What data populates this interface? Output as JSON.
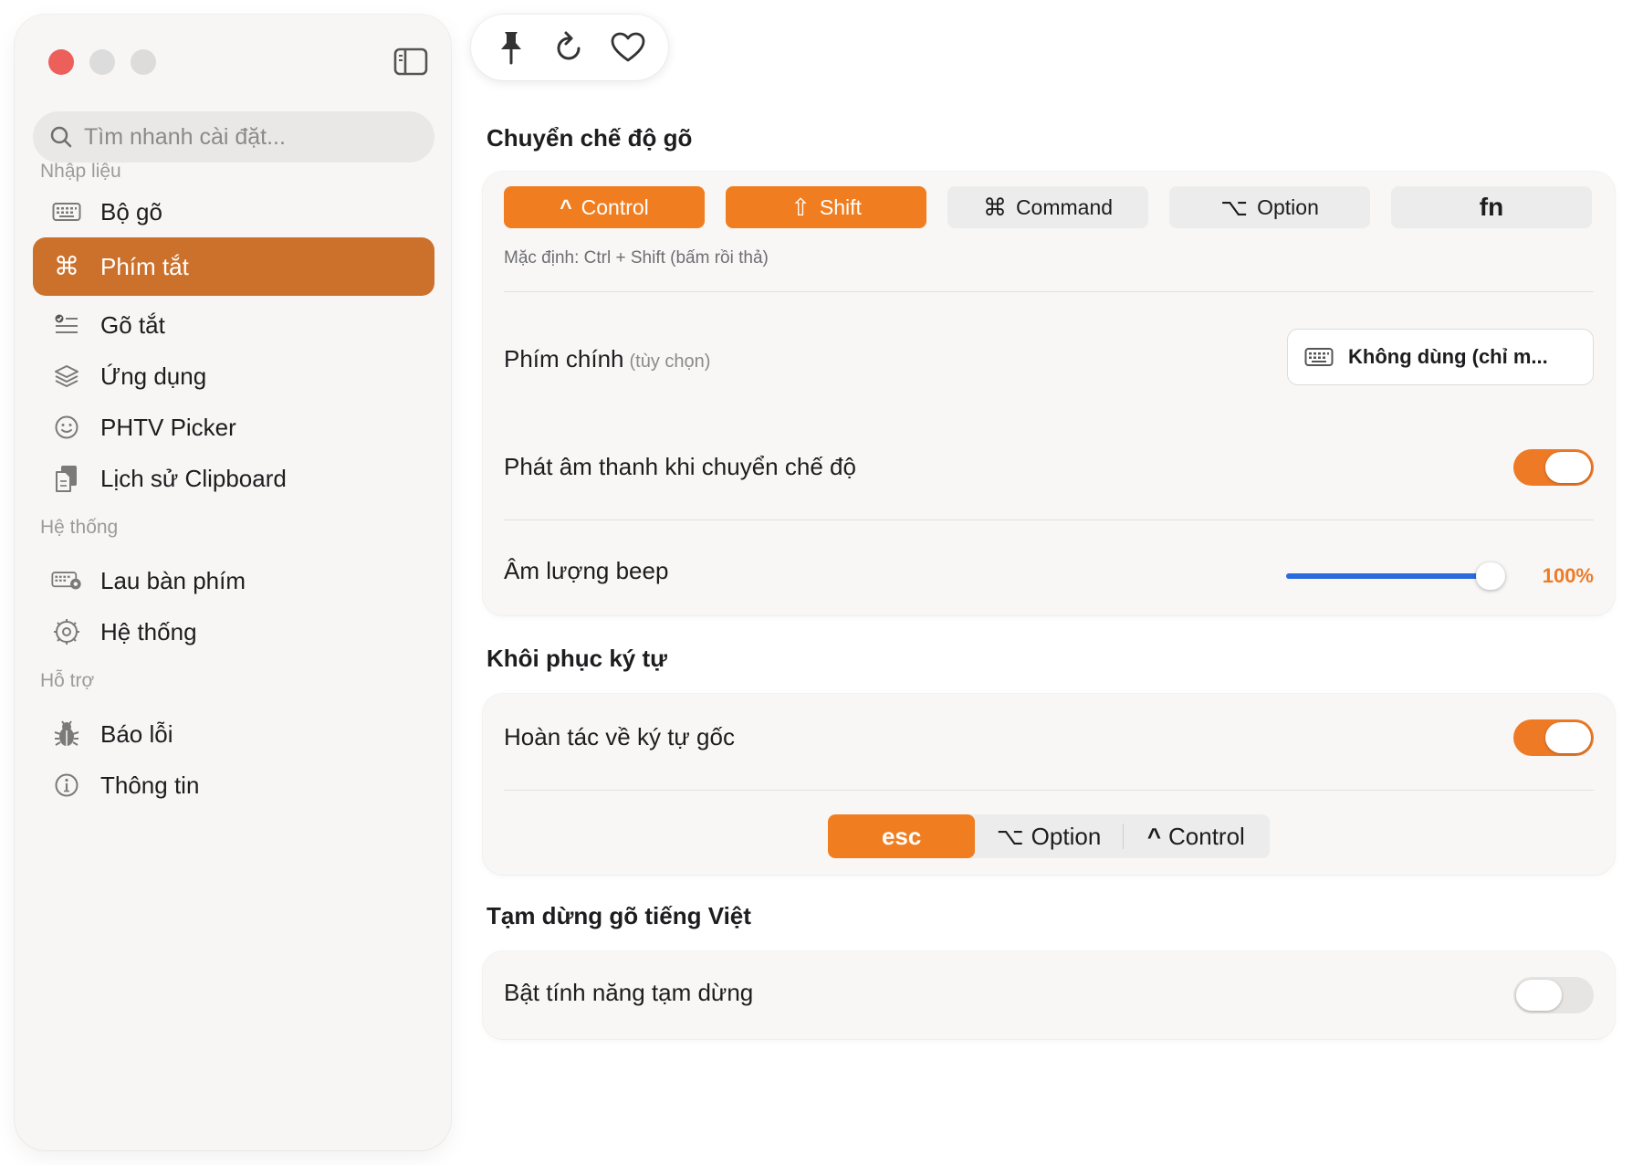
{
  "sidebar": {
    "search_placeholder": "Tìm nhanh cài đặt...",
    "sections": {
      "input": "Nhập liệu",
      "system": "Hệ thống",
      "support": "Hỗ trợ"
    },
    "items": [
      {
        "label": "Bộ gõ",
        "icon": "keyboard-icon"
      },
      {
        "label": "Phím tắt",
        "icon": "command-icon",
        "active": true
      },
      {
        "label": "Gõ tắt",
        "icon": "checklist-icon"
      },
      {
        "label": "Ứng dụng",
        "icon": "layers-icon"
      },
      {
        "label": "PHTV Picker",
        "icon": "smiley-icon"
      },
      {
        "label": "Lịch sử Clipboard",
        "icon": "clipboard-icon"
      },
      {
        "label": "Lau bàn phím",
        "icon": "keyboard-clean-icon"
      },
      {
        "label": "Hệ thống",
        "icon": "gear-icon"
      },
      {
        "label": "Báo lỗi",
        "icon": "bug-icon"
      },
      {
        "label": "Thông tin",
        "icon": "info-icon"
      }
    ]
  },
  "toolbar": {
    "icons": [
      "pin-icon",
      "refresh-icon",
      "heart-icon"
    ]
  },
  "switch_mode": {
    "title": "Chuyển chế độ gõ",
    "keys": [
      {
        "label": "Control",
        "glyph": "^",
        "active": true
      },
      {
        "label": "Shift",
        "glyph": "⇧",
        "active": true
      },
      {
        "label": "Command",
        "glyph": "⌘",
        "active": false
      },
      {
        "label": "Option",
        "glyph": "⌥",
        "active": false
      },
      {
        "label": "fn",
        "glyph": "",
        "active": false
      }
    ],
    "hint": "Mặc định: Ctrl + Shift (bấm rồi thả)",
    "main_key_label": "Phím chính",
    "main_key_sub": "(tùy chọn)",
    "main_key_value": "Không dùng (chỉ m...",
    "sound_label": "Phát âm thanh khi chuyển chế độ",
    "sound_on": true,
    "volume_label": "Âm lượng beep",
    "volume_value": "100%",
    "volume_level": 1.0
  },
  "restore": {
    "title": "Khôi phục ký tự",
    "undo_label": "Hoàn tác về ký tự gốc",
    "undo_on": true,
    "segments": [
      {
        "label": "esc",
        "glyph": "",
        "active": true
      },
      {
        "label": "Option",
        "glyph": "⌥",
        "active": false
      },
      {
        "label": "Control",
        "glyph": "^",
        "active": false
      }
    ]
  },
  "pause": {
    "title": "Tạm dừng gõ tiếng Việt",
    "enable_label": "Bật tính năng tạm dừng",
    "enable_on": false
  },
  "colors": {
    "accent": "#f07e20",
    "sidebar_active": "#cc712c",
    "slider": "#2a6bde"
  }
}
